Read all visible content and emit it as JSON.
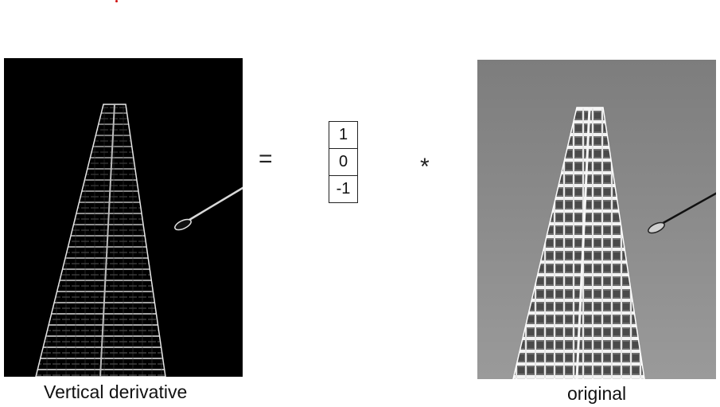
{
  "captions": {
    "derivative": "Vertical derivative",
    "original": "original"
  },
  "operators": {
    "equals": "=",
    "convolve": "*"
  },
  "kernel": {
    "values": [
      "1",
      "0",
      "-1"
    ]
  },
  "images": {
    "derivative": "derivative-building-image",
    "original": "original-building-image"
  },
  "colors": {
    "derivative_background": "#000000",
    "original_sky": "#8a8a8a",
    "marker_dot": "#d01010"
  }
}
